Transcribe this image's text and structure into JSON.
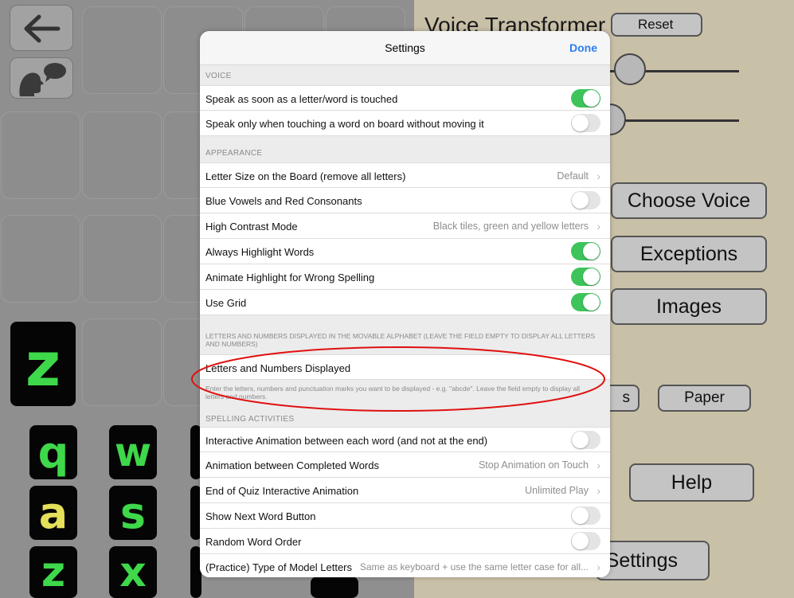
{
  "background": {
    "panel_title": "Voice Transformer",
    "reset_label": "Reset",
    "choose_voice_label": "Choose Voice",
    "exceptions_label": "Exceptions",
    "images_label": "Images",
    "letters_partial_label": "s",
    "paper_label": "Paper",
    "help_label": "Help",
    "settings_partial_label": "Settings",
    "big_tile_letter": "z",
    "tiles": {
      "q": "q",
      "w": "w",
      "a": "a",
      "s": "s",
      "z2": "z",
      "x": "x"
    }
  },
  "modal": {
    "title": "Settings",
    "done_label": "Done",
    "sections": {
      "voice": "VOICE",
      "appearance": "APPEARANCE",
      "letters": "LETTERS AND NUMBERS DISPLAYED IN THE MOVABLE ALPHABET (LEAVE THE FIELD EMPTY TO DISPLAY ALL LETTERS AND NUMBERS)",
      "spelling": "SPELLING ACTIVITIES"
    },
    "rows": {
      "speak_touched": {
        "label": "Speak as soon as a letter/word is touched",
        "on": true
      },
      "speak_no_move": {
        "label": "Speak only when touching a word on board without moving it",
        "on": false
      },
      "letter_size": {
        "label": "Letter Size on the Board (remove all letters)",
        "value": "Default"
      },
      "blue_vowels": {
        "label": "Blue Vowels and Red Consonants",
        "on": false
      },
      "high_contrast": {
        "label": "High Contrast Mode",
        "value": "Black tiles, green and yellow letters"
      },
      "always_highlight": {
        "label": "Always Highlight Words",
        "on": true
      },
      "animate_highlight": {
        "label": "Animate Highlight for Wrong Spelling",
        "on": true
      },
      "use_grid": {
        "label": "Use Grid",
        "on": true
      },
      "letters_displayed": {
        "label": "Letters and Numbers Displayed"
      },
      "interactive_animation": {
        "label": "Interactive Animation between each word (and not at the end)",
        "on": false
      },
      "animation_completed": {
        "label": "Animation between Completed Words",
        "value": "Stop Animation on Touch"
      },
      "end_quiz": {
        "label": "End of Quiz Interactive Animation",
        "value": "Unlimited Play"
      },
      "show_next": {
        "label": "Show Next Word Button",
        "on": false
      },
      "random_order": {
        "label": "Random Word Order",
        "on": false
      },
      "model_letters": {
        "label": "(Practice) Type of Model Letters",
        "value": "Same as keyboard + use the same letter case for all..."
      }
    },
    "letters_note": "Enter the letters, numbers and punctuation marks you want to be displayed - e.g. \"abcde\". Leave the field empty to display all letters and numbers."
  },
  "colors": {
    "toggle_on": "#3ec45a",
    "accent": "#2b7ff5",
    "annotation": "#e01010",
    "tile_letter": "#3ed84a"
  }
}
